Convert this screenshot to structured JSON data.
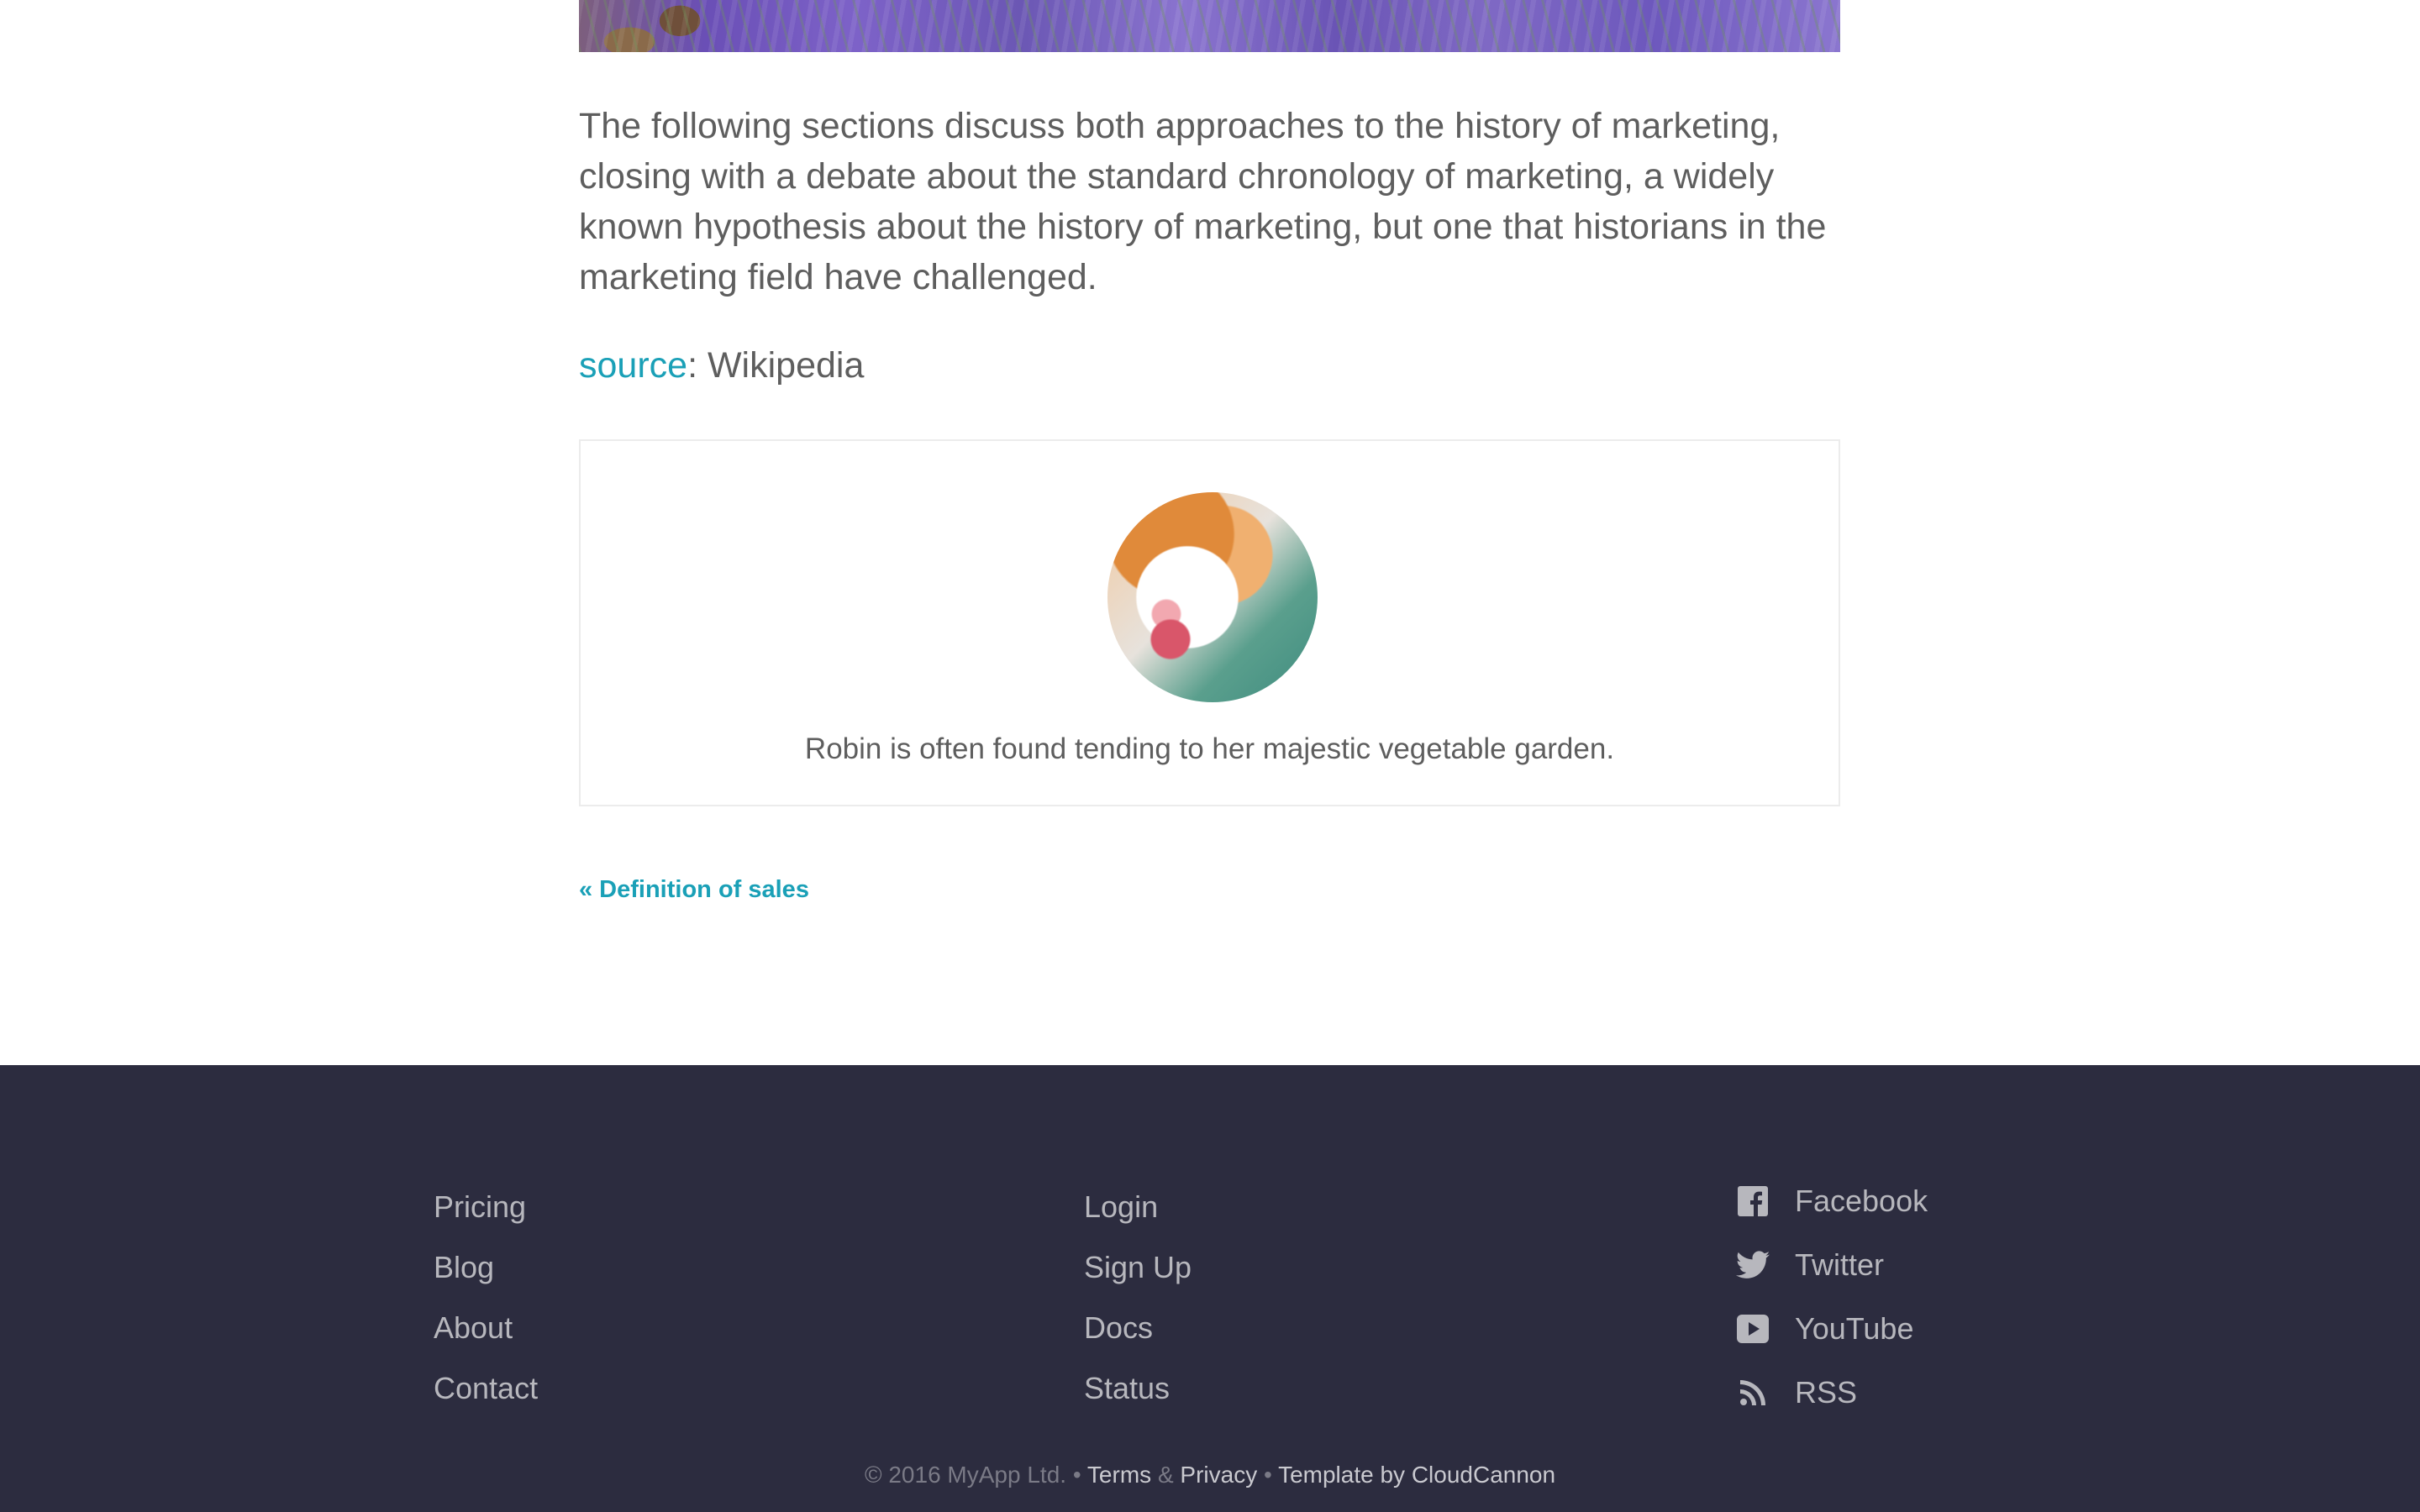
{
  "article": {
    "paragraph": "The following sections discuss both approaches to the history of marketing, closing with a debate about the standard chronology of marketing, a widely known hypothesis about the history of marketing, but one that historians in the marketing field have challenged.",
    "source_label": "source",
    "source_value": ": Wikipedia"
  },
  "author_card": {
    "caption": "Robin is often found tending to her majestic vegetable garden."
  },
  "navigation": {
    "prev_label": "« Definition of sales"
  },
  "footer": {
    "col1": [
      "Pricing",
      "Blog",
      "About",
      "Contact"
    ],
    "col2": [
      "Login",
      "Sign Up",
      "Docs",
      "Status"
    ],
    "social": [
      {
        "label": "Facebook",
        "icon": "facebook-icon"
      },
      {
        "label": "Twitter",
        "icon": "twitter-icon"
      },
      {
        "label": "YouTube",
        "icon": "youtube-icon"
      },
      {
        "label": "RSS",
        "icon": "rss-icon"
      }
    ],
    "copyright": "© 2016 MyApp Ltd.",
    "bullet": "•",
    "terms": "Terms",
    "amp": "&",
    "privacy": "Privacy",
    "template_by": "Template by CloudCannon"
  },
  "colors": {
    "accent": "#1aa0b7",
    "footer_bg": "#2c2c3f"
  }
}
